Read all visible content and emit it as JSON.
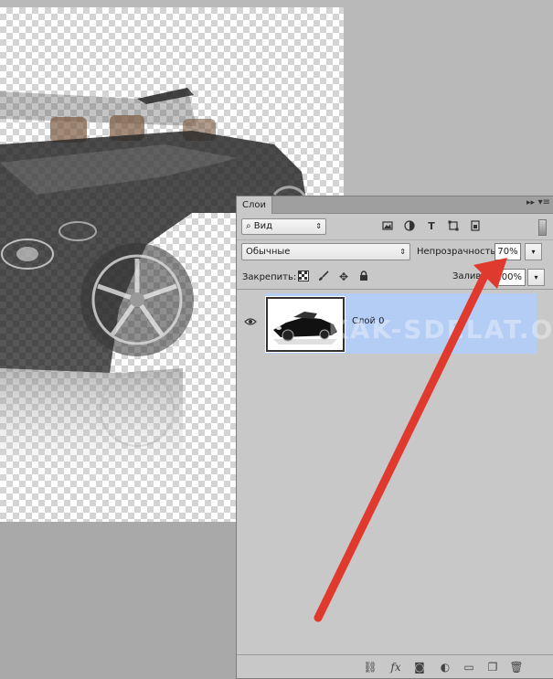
{
  "canvas": {
    "watermark_text": "KAK-SDELAT.ORG"
  },
  "layers_panel": {
    "tab_label": "Слои",
    "collapse_glyph": "▸▸",
    "menu_glyph": "▾≡",
    "filter": {
      "label": "Вид",
      "search_glyph": "⌕",
      "arrow": "⇕",
      "icons": [
        "image-filter-icon",
        "adjustment-filter-icon",
        "type-filter-icon",
        "shape-filter-icon",
        "smart-object-filter-icon"
      ]
    },
    "blend_mode": {
      "value": "Обычные",
      "arrow": "⇕"
    },
    "opacity": {
      "label": "Непрозрачность:",
      "value": "70%",
      "dropdown_glyph": "▾"
    },
    "lock": {
      "label": "Закрепить:",
      "icons": [
        "lock-transparent-pixels-icon",
        "lock-image-pixels-icon",
        "lock-position-icon",
        "lock-all-icon"
      ]
    },
    "fill": {
      "label": "Заливка:",
      "value": "100%",
      "dropdown_glyph": "▾"
    },
    "layers": [
      {
        "name": "Слой 0",
        "visible": true,
        "selected": true
      }
    ],
    "footer_icons": [
      "link-layers-icon",
      "layer-style-icon",
      "add-mask-icon",
      "adjustment-layer-icon",
      "new-group-icon",
      "new-layer-icon",
      "delete-layer-icon"
    ],
    "footer_glyphs": {
      "link": "⛓",
      "fx": "fx",
      "mask": "◙",
      "adjust": "◐",
      "group": "▭",
      "new": "❐",
      "trash": "🗑"
    }
  },
  "annotation": {
    "arrow_color": "#e03a2f"
  }
}
